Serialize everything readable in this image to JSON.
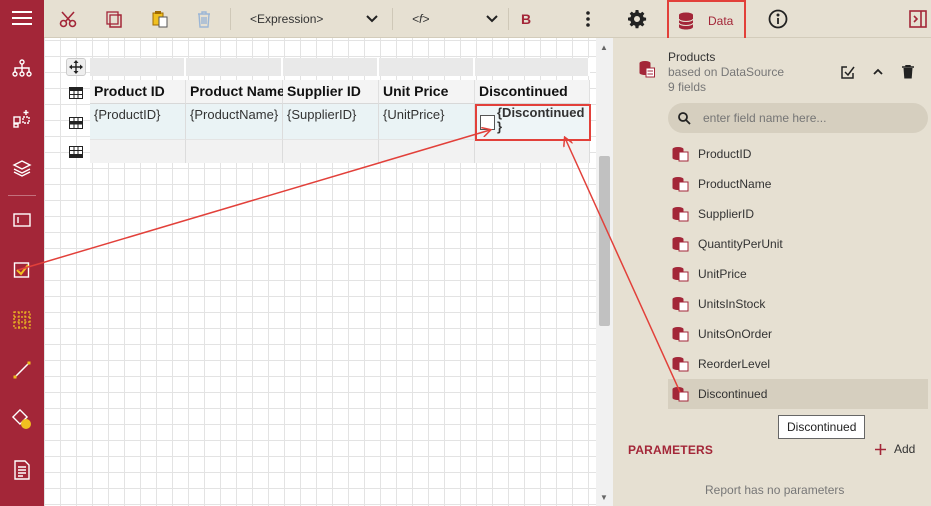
{
  "toolbar": {
    "expression_label": "<Expression>",
    "function_label": "<f>",
    "bold_label": "B",
    "data_label": "Data"
  },
  "table": {
    "headers": [
      "Product ID",
      "Product Name",
      "Supplier ID",
      "Unit Price",
      "Discontinued"
    ],
    "cells": [
      "{ProductID}",
      "{ProductName}",
      "{SupplierID}",
      "{UnitPrice}"
    ],
    "discontinued_line1": "{Discontinued",
    "discontinued_line2": "}"
  },
  "datasource": {
    "name": "Products",
    "subtitle": "based on DataSource",
    "count": "9 fields",
    "search_placeholder": "enter field name here...",
    "fields": [
      "ProductID",
      "ProductName",
      "SupplierID",
      "QuantityPerUnit",
      "UnitPrice",
      "UnitsInStock",
      "UnitsOnOrder",
      "ReorderLevel",
      "Discontinued"
    ],
    "selected_field": "Discontinued"
  },
  "tooltip": "Discontinued",
  "parameters": {
    "title": "PARAMETERS",
    "add_label": "Add",
    "empty": "Report has no parameters"
  },
  "colors": {
    "brand": "#a32638",
    "highlight": "#e2403a",
    "panel": "#e6e0d2"
  }
}
